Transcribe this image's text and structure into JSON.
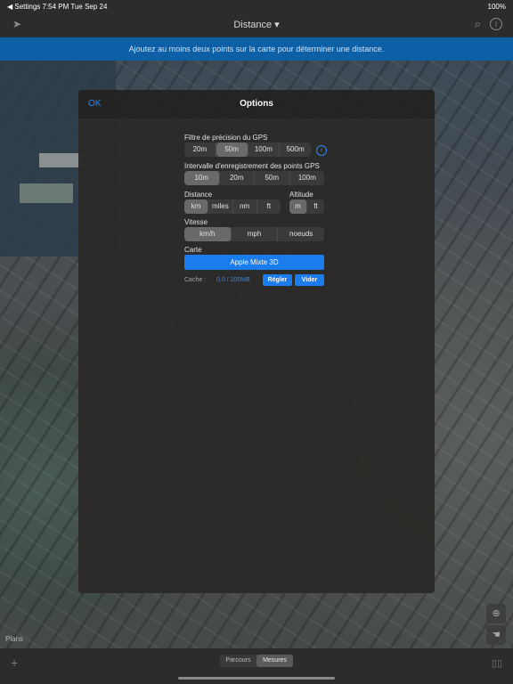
{
  "status": {
    "left": "◀ Settings  7:54 PM  Tue Sep 24",
    "right": "100%"
  },
  "topbar": {
    "title": "Distance ▾"
  },
  "banner": {
    "text": "Ajoutez au moins deux points sur la carte pour déterminer une distance."
  },
  "dialog": {
    "ok": "OK",
    "title": "Options",
    "gps_filter": {
      "label": "Filtre de précision du GPS",
      "options": [
        "20m",
        "50m",
        "100m",
        "500m"
      ],
      "selected": 1
    },
    "record_interval": {
      "label": "Intervalle d'enregistrement des points GPS",
      "options": [
        "10m",
        "20m",
        "50m",
        "100m"
      ],
      "selected": 0
    },
    "distance": {
      "label": "Distance",
      "options": [
        "km",
        "miles",
        "nm",
        "ft"
      ],
      "selected": 0
    },
    "altitude": {
      "label": "Altitude",
      "options": [
        "m",
        "ft"
      ],
      "selected": 0
    },
    "speed": {
      "label": "Vitesse",
      "options": [
        "km/h",
        "mph",
        "noeuds"
      ],
      "selected": 0
    },
    "map": {
      "label": "Carte",
      "value": "Apple Mixte 3D"
    },
    "cache": {
      "label": "Cache :",
      "value": "0,0 / 200MB",
      "set_button": "Régler",
      "clear_button": "Vider"
    }
  },
  "bottombar": {
    "tabs": [
      "Parcours",
      "Mesures"
    ],
    "selected": 1
  },
  "map": {
    "attribution": "Plans"
  },
  "icons": {
    "nav": "location-arrow-icon",
    "search": "search-icon",
    "info": "info-icon",
    "plus": "plus-icon",
    "book": "book-icon",
    "locate": "crosshair-icon",
    "hand": "hand-icon"
  },
  "colors": {
    "accent": "#1a7ff2",
    "banner": "#0d5fa6",
    "dialog_bg": "#2b2a28"
  }
}
